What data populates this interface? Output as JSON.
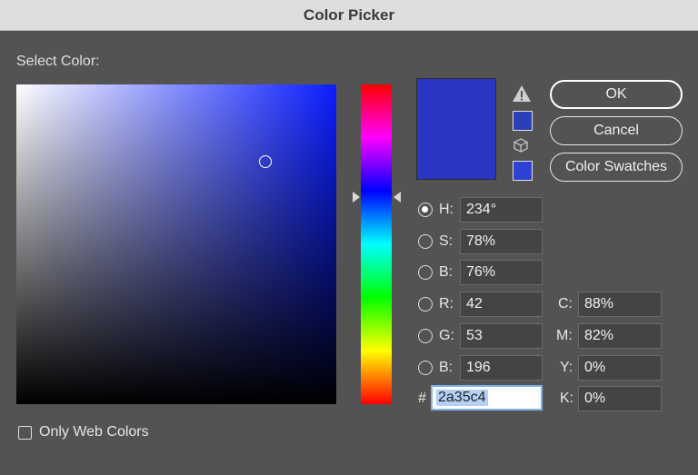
{
  "window": {
    "title": "Color Picker"
  },
  "select_color_label": "Select Color:",
  "picker": {
    "current_color": "#2a35c4",
    "hue_color": "#0a1dff"
  },
  "buttons": {
    "ok": "OK",
    "cancel": "Cancel",
    "swatches": "Color Swatches"
  },
  "icons": {
    "warning": "warning-triangle-icon",
    "cube": "cube-icon"
  },
  "alert_swatches": {
    "gamut": "#2a3fb8",
    "web": "#2f40d4"
  },
  "fields": {
    "H": {
      "label": "H:",
      "value": "234°",
      "selected": true
    },
    "S": {
      "label": "S:",
      "value": "78%",
      "selected": false
    },
    "B": {
      "label": "B:",
      "value": "76%",
      "selected": false
    },
    "R": {
      "label": "R:",
      "value": "42",
      "selected": false
    },
    "G": {
      "label": "G:",
      "value": "53",
      "selected": false
    },
    "Bl": {
      "label": "B:",
      "value": "196",
      "selected": false
    },
    "C": {
      "label": "C:",
      "value": "88%"
    },
    "M": {
      "label": "M:",
      "value": "82%"
    },
    "Y": {
      "label": "Y:",
      "value": "0%"
    },
    "K": {
      "label": "K:",
      "value": "0%"
    }
  },
  "hex": {
    "label": "#",
    "value": "2a35c4"
  },
  "only_web_colors": {
    "label": "Only Web Colors",
    "checked": false
  }
}
